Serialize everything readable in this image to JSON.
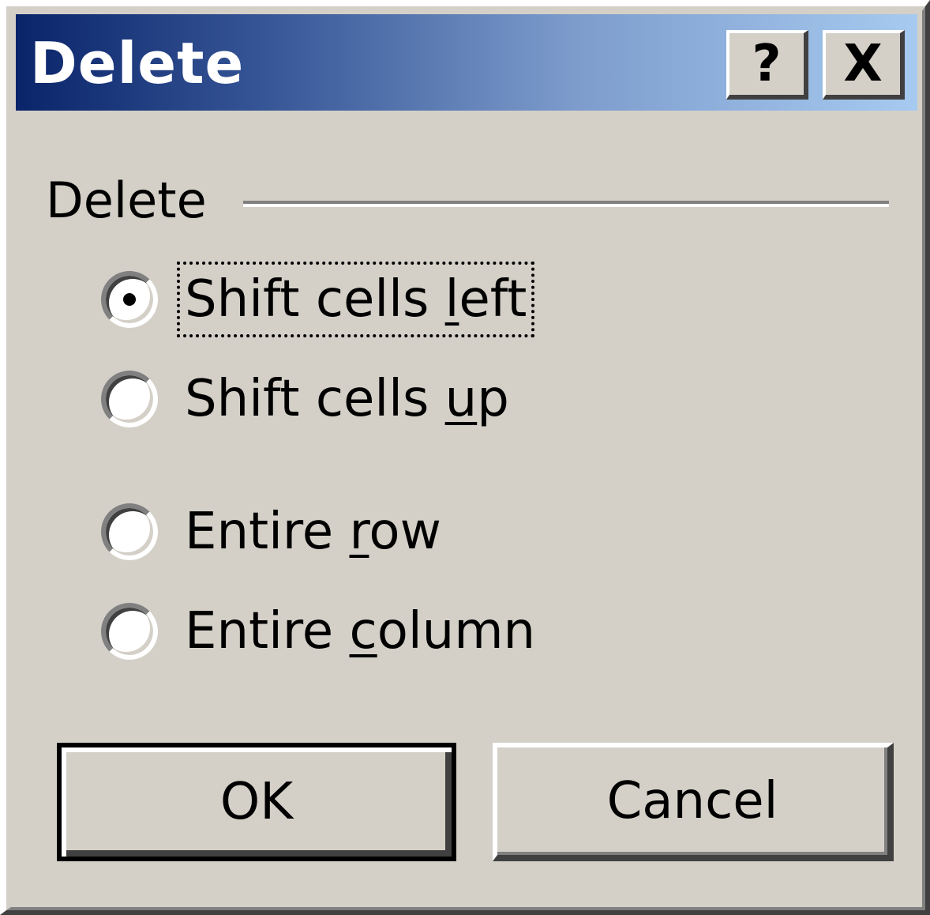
{
  "window": {
    "title": "Delete",
    "help_button": "?",
    "close_button": "X"
  },
  "group": {
    "label": "Delete"
  },
  "options": [
    {
      "pre": "Shift cells ",
      "accel": "l",
      "post": "eft",
      "selected": true,
      "focused": true
    },
    {
      "pre": "Shift cells ",
      "accel": "u",
      "post": "p",
      "selected": false,
      "focused": false
    },
    {
      "pre": "Entire ",
      "accel": "r",
      "post": "ow",
      "selected": false,
      "focused": false
    },
    {
      "pre": "Entire ",
      "accel": "c",
      "post": "olumn",
      "selected": false,
      "focused": false
    }
  ],
  "buttons": {
    "ok_label": "OK",
    "cancel_label": "Cancel"
  }
}
